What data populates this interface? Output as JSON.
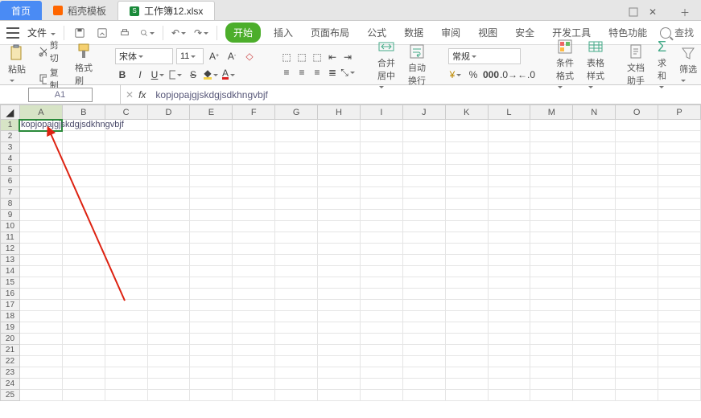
{
  "tabs": {
    "home": "首页",
    "template": "稻壳模板",
    "file": "工作簿12.xlsx"
  },
  "file_menu_label": "文件",
  "ribbon": {
    "tabs": [
      "开始",
      "插入",
      "页面布局",
      "公式",
      "数据",
      "审阅",
      "视图",
      "安全",
      "开发工具",
      "特色功能"
    ],
    "active_index": 0,
    "search_label": "查找"
  },
  "clipboard": {
    "paste": "粘贴",
    "cut": "剪切",
    "copy": "复制",
    "format_painter": "格式刷"
  },
  "font": {
    "name": "宋体",
    "size": "11"
  },
  "number_format": "常规",
  "big_buttons": {
    "merge": "合并居中",
    "wrap": "自动换行",
    "cond_format": "条件格式",
    "table_style": "表格样式",
    "doc_helper": "文档助手",
    "sum": "求和",
    "filter": "筛选"
  },
  "name_box": "A1",
  "formula_text": "kopjopajgjskdgjsdkhngvbjf",
  "a1_value": "kopjopajgjskdgjsdkhngvbjf",
  "columns": [
    "A",
    "B",
    "C",
    "D",
    "E",
    "F",
    "G",
    "H",
    "I",
    "J",
    "K",
    "L",
    "M",
    "N",
    "O",
    "P"
  ],
  "row_count": 25
}
